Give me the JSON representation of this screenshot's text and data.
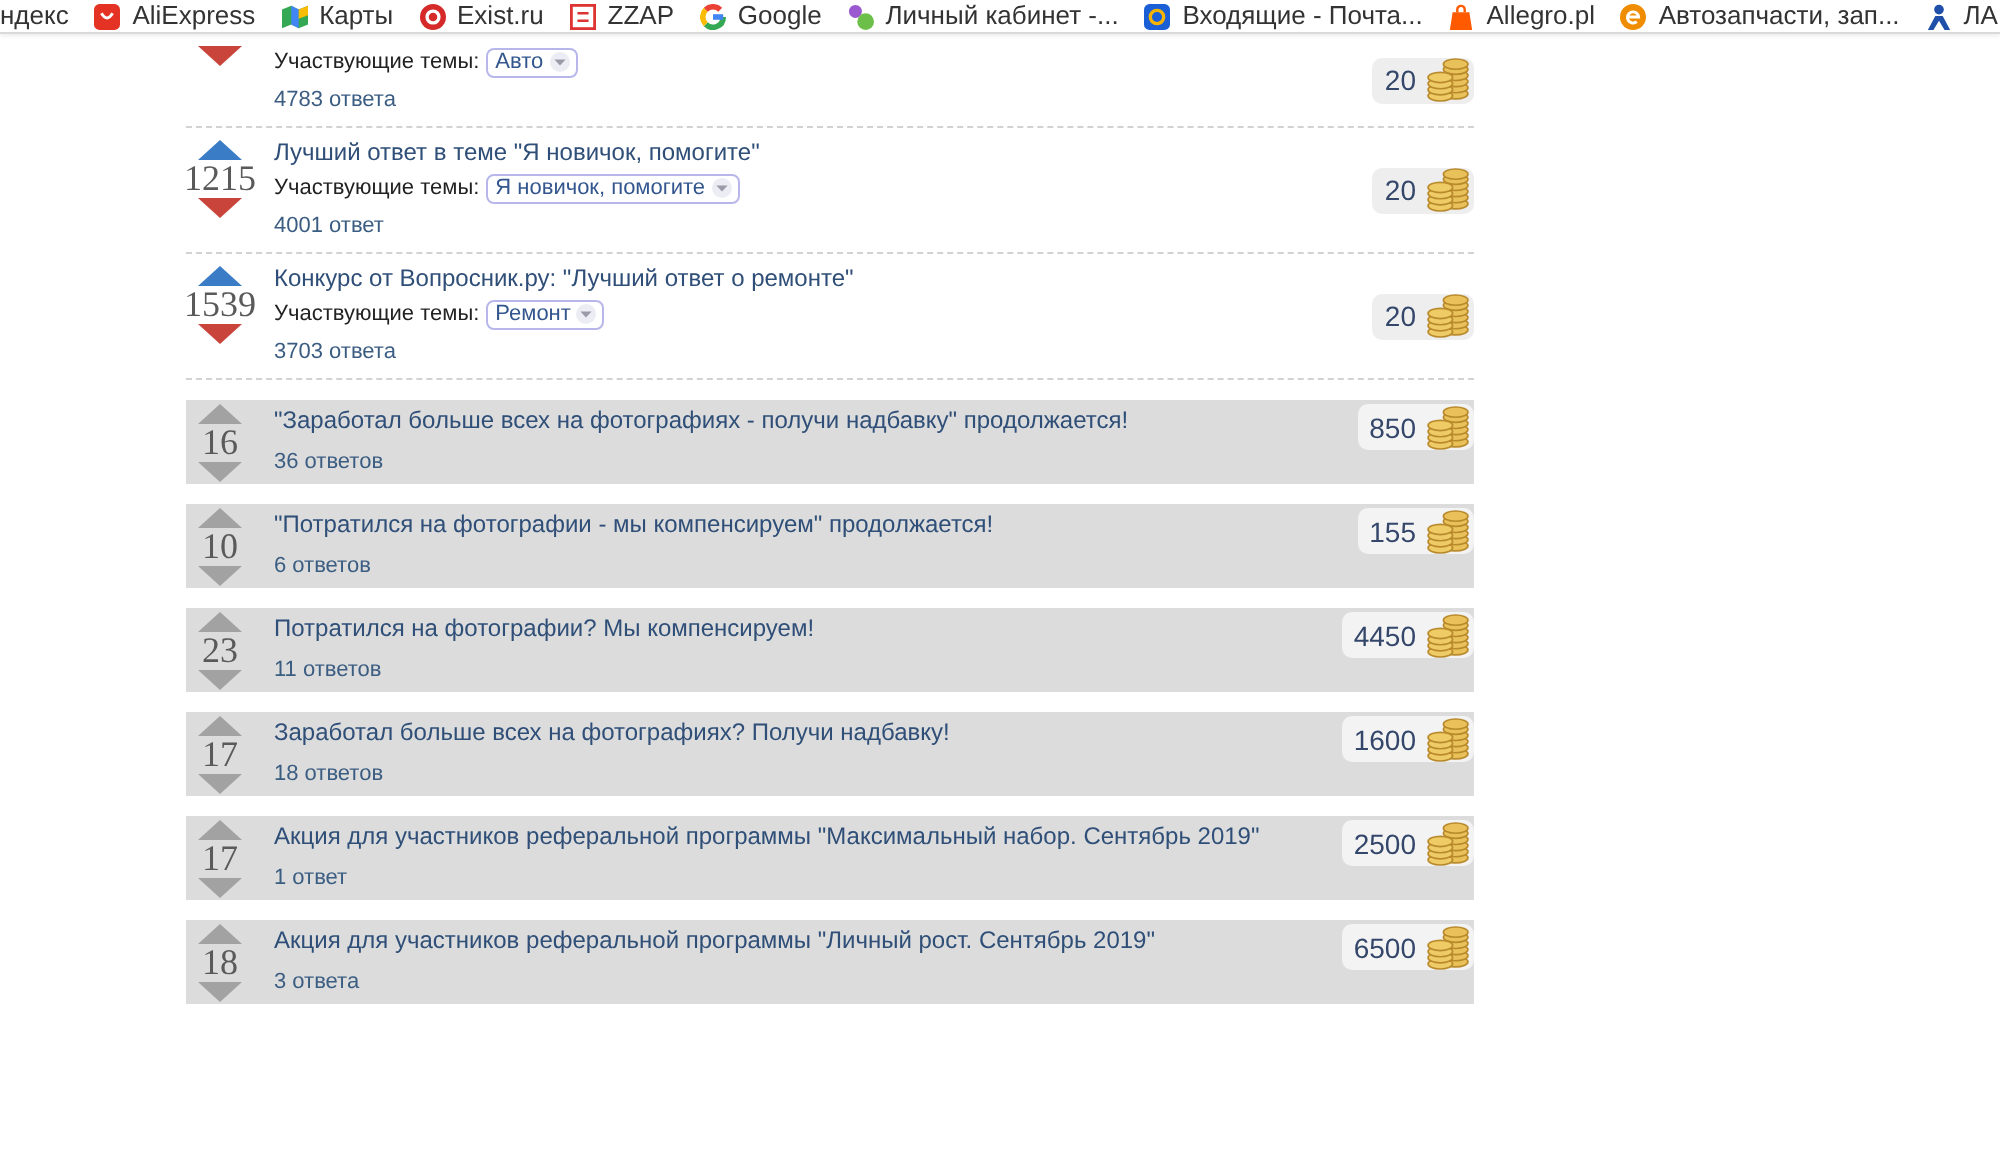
{
  "bookmarks_bar": {
    "items": [
      {
        "label": "ндекс"
      },
      {
        "label": "AliExpress"
      },
      {
        "label": "Карты"
      },
      {
        "label": "Exist.ru"
      },
      {
        "label": "ZZAP"
      },
      {
        "label": "Google"
      },
      {
        "label": "Личный кабинет -..."
      },
      {
        "label": "Входящие - Почта..."
      },
      {
        "label": "Allegro.pl"
      },
      {
        "label": "Автозапчасти, зап..."
      },
      {
        "label": "ЛА"
      }
    ]
  },
  "contests": [
    {
      "kind": "plain",
      "topics_label": "Участвующие темы:",
      "topics": [
        "Авто"
      ],
      "answers": "4783 ответа",
      "reward": "20"
    },
    {
      "kind": "plain",
      "votes": "1215",
      "title": "Лучший ответ в теме \"Я новичок, помогите\"",
      "topics_label": "Участвующие темы:",
      "topics": [
        "Я новичок, помогите"
      ],
      "answers": "4001 ответ",
      "reward": "20"
    },
    {
      "kind": "plain",
      "votes": "1539",
      "title": "Конкурс от Вопросник.ру: \"Лучший ответ о ремонте\"",
      "topics_label": "Участвующие темы:",
      "topics": [
        "Ремонт"
      ],
      "answers": "3703 ответа",
      "reward": "20"
    },
    {
      "kind": "shaded",
      "votes": "16",
      "title": "\"Заработал больше всех на фотографиях - получи надбавку\" продолжается!",
      "answers": "36 ответов",
      "reward": "850"
    },
    {
      "kind": "shaded",
      "votes": "10",
      "title": "\"Потратился на фотографии - мы компенсируем\" продолжается!",
      "answers": "6 ответов",
      "reward": "155"
    },
    {
      "kind": "shaded",
      "votes": "23",
      "title": "Потратился на фотографии? Мы компенсируем!",
      "answers": "11 ответов",
      "reward": "4450"
    },
    {
      "kind": "shaded",
      "votes": "17",
      "title": "Заработал больше всех на фотографиях? Получи надбавку!",
      "answers": "18 ответов",
      "reward": "1600"
    },
    {
      "kind": "shaded",
      "votes": "17",
      "title": "Акция для участников реферальной программы \"Максимальный набор. Сентябрь 2019\"",
      "answers": "1 ответ",
      "reward": "2500"
    },
    {
      "kind": "shaded",
      "votes": "18",
      "title": "Акция для участников реферальной программы \"Личный рост. Сентябрь 2019\"",
      "answers": "3 ответа",
      "reward": "6500"
    }
  ]
}
